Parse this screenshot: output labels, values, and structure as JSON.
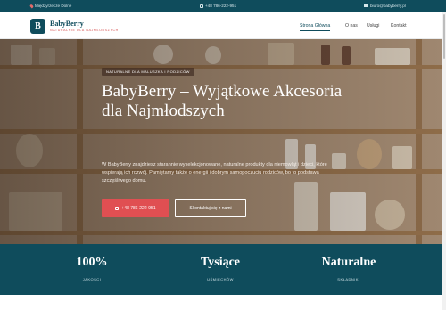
{
  "topbar": {
    "location": "Międzyrzecze Dolne",
    "phone": "+48 786-222-951",
    "email": "biuro@babyberry.pl"
  },
  "brand": {
    "logo_letter": "B",
    "name": "BabyBerry",
    "tagline": "NATURALNIE DLA NAJMŁODSZYCH"
  },
  "nav": {
    "items": [
      {
        "label": "Strona Główna",
        "active": true
      },
      {
        "label": "O nas",
        "active": false
      },
      {
        "label": "Usługi",
        "active": false
      },
      {
        "label": "Kontakt",
        "active": false
      }
    ]
  },
  "hero": {
    "badge": "NATURALNE DLA MALUSZKA I RODZICÓW",
    "title": "BabyBerry – Wyjątkowe Akcesoria dla Najmłodszych",
    "text": "W BabyBerry znajdziesz starannie wyselekcjonowane, naturalne produkty dla niemowląt i dzieci, które wspierają ich rozwój. Pamiętamy także o energii i dobrym samopoczuciu rodziców, bo to podstawa szczęśliwego domu.",
    "phone_button": "+48 786-222-951",
    "contact_button": "Skontaktuj się z nami"
  },
  "stats": [
    {
      "value": "100%",
      "label": "JAKOŚCI"
    },
    {
      "value": "Tysiące",
      "label": "UŚMIECHÓW"
    },
    {
      "value": "Naturalne",
      "label": "SKŁADNIKI"
    }
  ],
  "colors": {
    "primary": "#0f4c5c",
    "accent": "#e04f52"
  },
  "icons": {
    "location": "map-pin-icon",
    "phone": "phone-icon",
    "email": "mail-icon"
  }
}
